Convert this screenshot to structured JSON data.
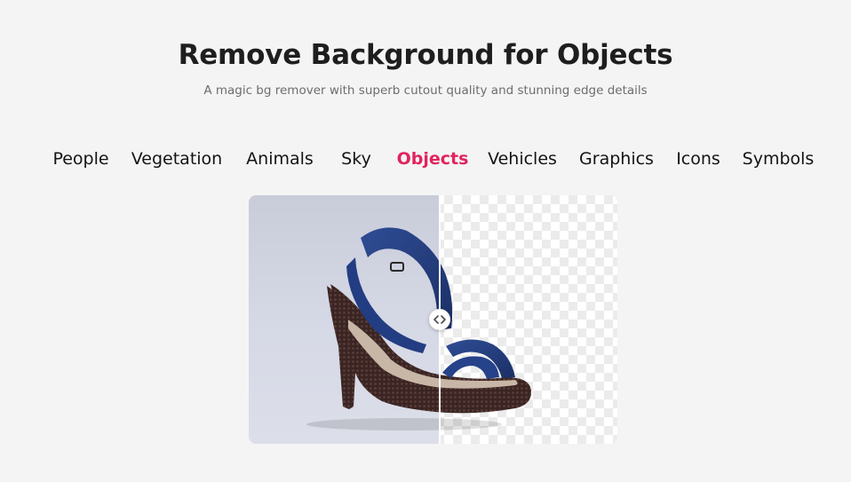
{
  "header": {
    "title": "Remove Background for Objects",
    "subtitle": "A magic bg remover with superb cutout quality and stunning edge details"
  },
  "tabs": [
    {
      "label": "People",
      "active": false
    },
    {
      "label": "Vegetation",
      "active": false
    },
    {
      "label": "Animals",
      "active": false
    },
    {
      "label": "Sky",
      "active": false
    },
    {
      "label": "Objects",
      "active": true
    },
    {
      "label": "Vehicles",
      "active": false
    },
    {
      "label": "Graphics",
      "active": false
    },
    {
      "label": "Icons",
      "active": false
    },
    {
      "label": "Symbols",
      "active": false
    }
  ],
  "comparison": {
    "before_image": "blue-strappy-high-heel-sandal-photo",
    "after_image": "blue-strappy-high-heel-sandal-cutout",
    "slider_position": 0.52,
    "handle_icon": "left-right-arrows-icon"
  },
  "colors": {
    "accent": "#e0245e",
    "background": "#f4f4f4",
    "title": "#1e1e1e",
    "subtitle": "#6d6d6d"
  }
}
